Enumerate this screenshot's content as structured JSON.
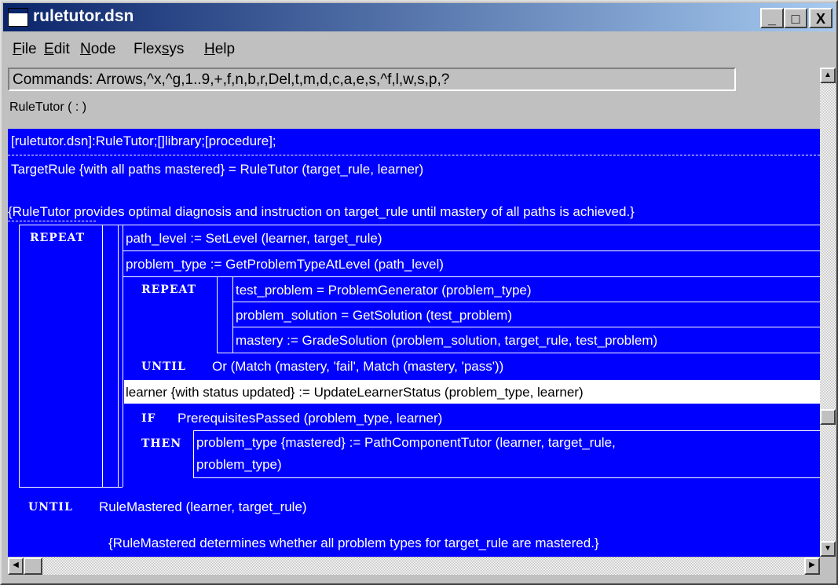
{
  "window": {
    "title": "ruletutor.dsn",
    "controls": [
      "_",
      "□",
      "X"
    ]
  },
  "menu": [
    {
      "pre": "",
      "u": "F",
      "post": "ile"
    },
    {
      "pre": "",
      "u": "E",
      "post": "dit"
    },
    {
      "pre": "",
      "u": "N",
      "post": "ode"
    },
    {
      "pre": "Flex",
      "u": "s",
      "post": "ys"
    },
    {
      "pre": "",
      "u": "H",
      "post": "elp"
    }
  ],
  "commands": "Commands: Arrows,^x,^g,1..9,+,f,n,b,r,Del,t,m,d,c,a,e,s,^f,l,w,s,p,?",
  "procedure_label": "RuleTutor ( : )",
  "code": {
    "header": "[ruletutor.dsn]:RuleTutor;[]library;[procedure];",
    "signature": "TargetRule {with all paths mastered} = RuleTutor (target_rule, learner)",
    "comment_top": "{RuleTutor provides optimal diagnosis and instruction on target_rule until mastery of all paths is achieved.}",
    "kw_repeat": "REPEAT",
    "kw_until": "UNTIL",
    "kw_if": "IF",
    "kw_then": "THEN",
    "line_path_level": "path_level := SetLevel (learner, target_rule)",
    "line_problem_type": "problem_type := GetProblemTypeAtLevel (path_level)",
    "line_test_problem": "test_problem = ProblemGenerator (problem_type)",
    "line_problem_solution": "problem_solution = GetSolution (test_problem)",
    "line_mastery": "mastery := GradeSolution (problem_solution, target_rule, test_problem)",
    "inner_until": "Or (Match (mastery, 'fail', Match (mastery, 'pass'))",
    "line_learner": "learner {with status updated} := UpdateLearnerStatus (problem_type, learner)",
    "if_condition": "PrerequisitesPassed (problem_type, learner)",
    "then_line1": "problem_type {mastered} := PathComponentTutor (learner, target_rule,",
    "then_line2": "problem_type)",
    "outer_until": "RuleMastered (learner, target_rule)",
    "comment_bottom": "{RuleMastered determines whether all problem types for target_rule are mastered.}"
  }
}
